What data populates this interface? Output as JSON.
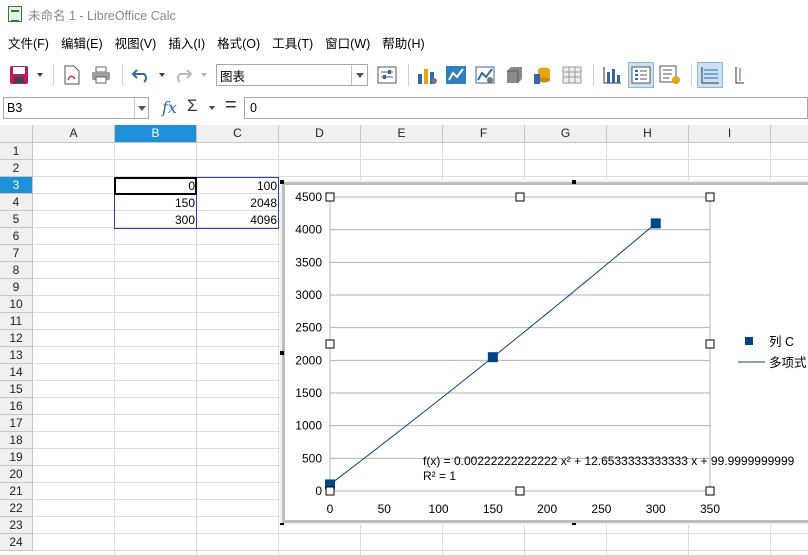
{
  "window": {
    "title": "未命名 1 - LibreOffice Calc"
  },
  "menu": [
    {
      "label": "文件(F)"
    },
    {
      "label": "编辑(E)"
    },
    {
      "label": "视图(V)"
    },
    {
      "label": "插入(I)"
    },
    {
      "label": "格式(O)"
    },
    {
      "label": "工具(T)"
    },
    {
      "label": "窗口(W)"
    },
    {
      "label": "帮助(H)"
    }
  ],
  "toolbar": {
    "chart_type_value": "图表"
  },
  "formula": {
    "namebox": "B3",
    "fx": "fx",
    "sum": "Σ",
    "equals": "=",
    "content": "0"
  },
  "columns": [
    {
      "label": "A"
    },
    {
      "label": "B"
    },
    {
      "label": "C"
    },
    {
      "label": "D"
    },
    {
      "label": "E"
    },
    {
      "label": "F"
    },
    {
      "label": "G"
    },
    {
      "label": "H"
    },
    {
      "label": "I"
    }
  ],
  "rows": [
    "1",
    "2",
    "3",
    "4",
    "5",
    "6",
    "7",
    "8",
    "9",
    "10",
    "11",
    "12",
    "13",
    "14",
    "15",
    "16",
    "17",
    "18",
    "19",
    "20",
    "21",
    "22",
    "23",
    "24"
  ],
  "cells": {
    "b3": "0",
    "c3": "100",
    "b4": "150",
    "c4": "2048",
    "b5": "300",
    "c5": "4096"
  },
  "chart_data": {
    "type": "scatter",
    "x": [
      0,
      150,
      300
    ],
    "y": [
      100,
      2048,
      4096
    ],
    "xlim": [
      0,
      350
    ],
    "ylim": [
      0,
      4500
    ],
    "xticks": [
      0,
      50,
      100,
      150,
      200,
      250,
      300,
      350
    ],
    "yticks": [
      0,
      500,
      1000,
      1500,
      2000,
      2500,
      3000,
      3500,
      4000,
      4500
    ],
    "grid": "horizontal",
    "legend_position": "right",
    "series": [
      {
        "name": "列 C",
        "color": "#004586"
      }
    ],
    "trendline": {
      "name": "多项式",
      "equation": "f(x) = 0.00222222222222 x² + 12.6533333333333 x + 99.9999999999",
      "r2": "R² = 1",
      "coefficients": [
        0.00222222222222,
        12.6533333333333,
        99.9999999999
      ],
      "color": "#004586"
    }
  }
}
